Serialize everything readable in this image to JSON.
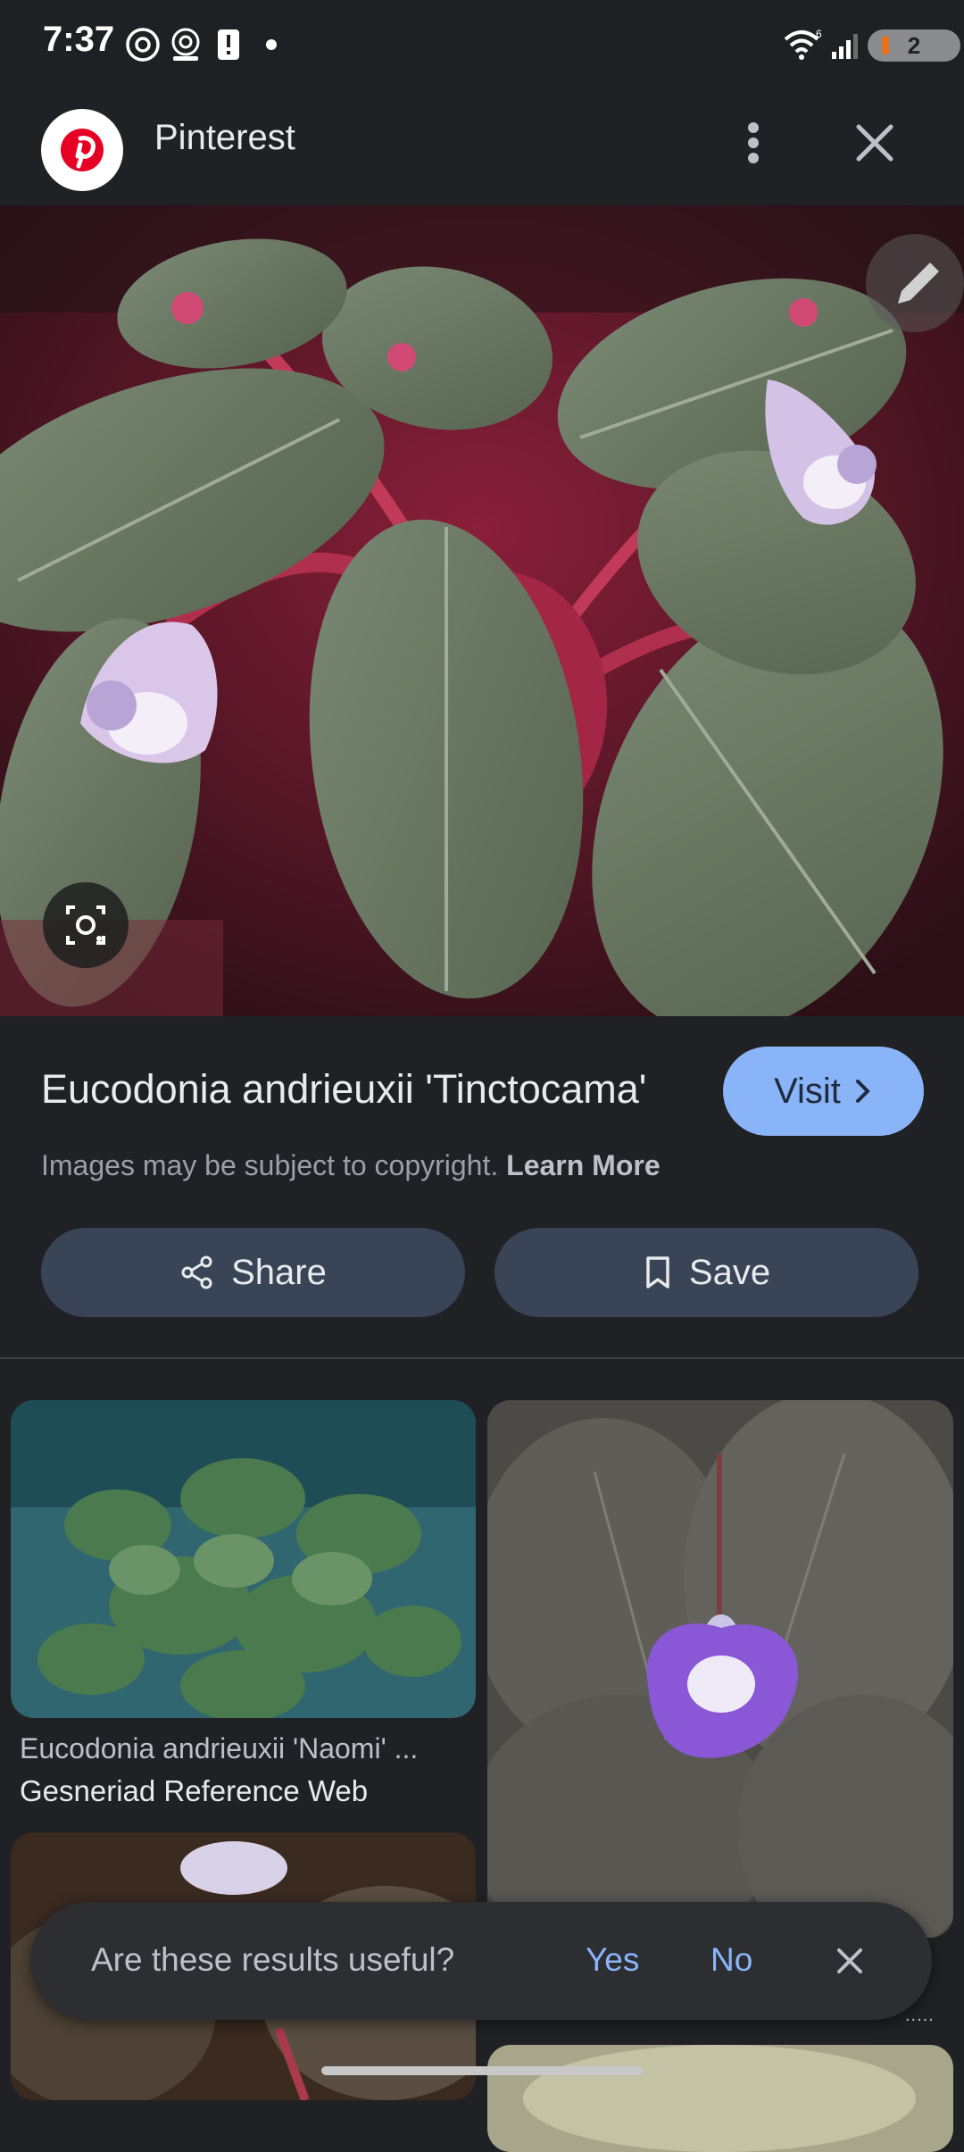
{
  "status_bar": {
    "time": "7:37",
    "battery_badge": "2",
    "icons": [
      "threads-icon",
      "webcam-icon",
      "alert-icon",
      "dot-icon",
      "wifi-icon",
      "signal-icon",
      "battery-icon"
    ]
  },
  "header": {
    "app_title": "Pinterest",
    "logo_icon": "pinterest-logo-icon",
    "logo_color": "#e60023",
    "menu_icon": "more-vert-icon",
    "close_icon": "close-icon"
  },
  "result": {
    "title": "Eucodonia andrieuxii 'Tinctocama'",
    "visit_label": "Visit",
    "copyright_text": "Images may be subject to copyright.",
    "learn_more_label": "Learn More",
    "share_label": "Share",
    "save_label": "Save",
    "accent_color": "#8ab4f8"
  },
  "related": [
    {
      "title": "Eucodonia andrieuxii 'Naomi' ...",
      "source": "Gesneriad Reference Web"
    }
  ],
  "feedback": {
    "question": "Are these results useful?",
    "yes_label": "Yes",
    "no_label": "No"
  },
  "misc": {
    "tiny_dots": "....."
  }
}
